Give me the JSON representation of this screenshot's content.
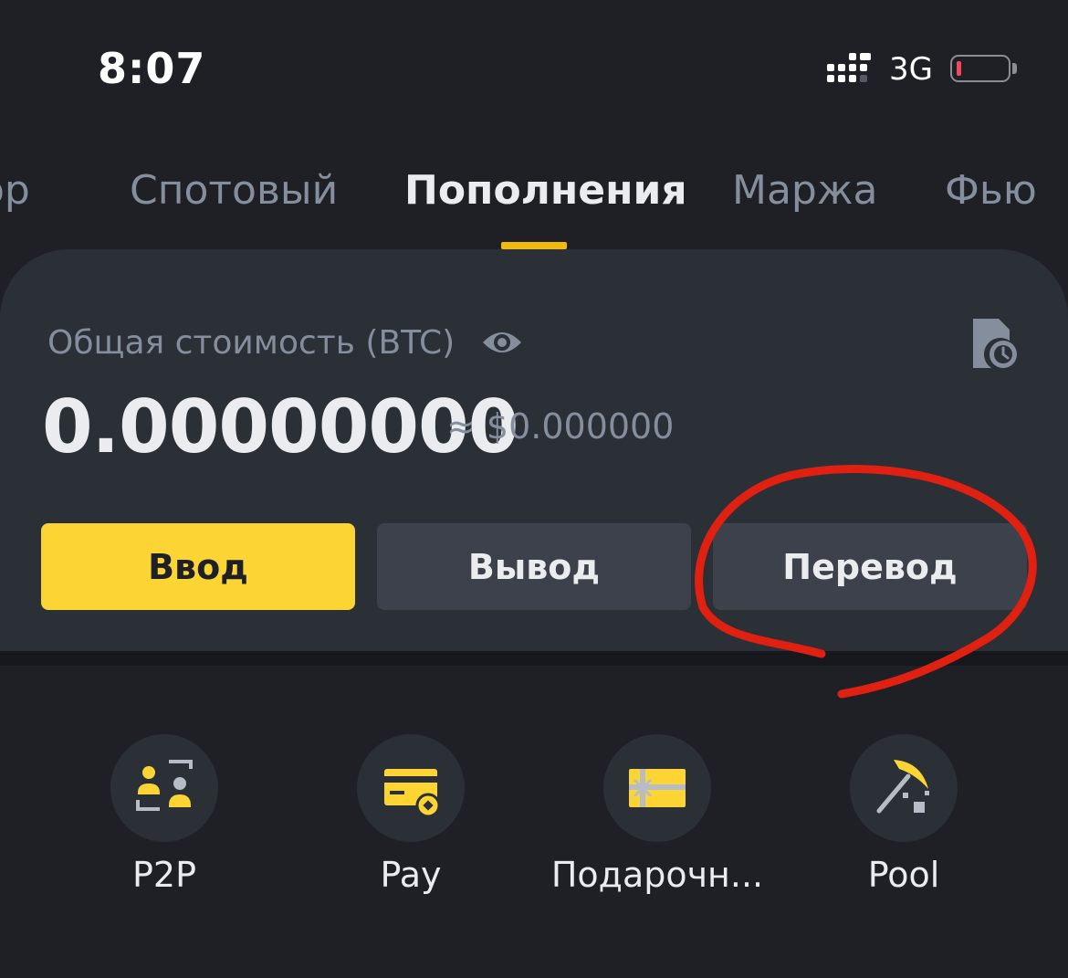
{
  "status_bar": {
    "time": "8:07",
    "network": "3G",
    "battery_color": "#f6465d"
  },
  "tabs": [
    {
      "label": "ор"
    },
    {
      "label": "Спотовый"
    },
    {
      "label": "Пополнения",
      "active": true
    },
    {
      "label": "Маржа"
    },
    {
      "label": "Фью"
    }
  ],
  "balance": {
    "label": "Общая стоимость (BTC)",
    "value": "0.00000000",
    "approx": "≈ $0.000000"
  },
  "actions": {
    "deposit": "Ввод",
    "withdraw": "Вывод",
    "transfer": "Перевод"
  },
  "quick_links": [
    {
      "label": "P2P",
      "icon": "p2p-icon"
    },
    {
      "label": "Pay",
      "icon": "pay-card-icon"
    },
    {
      "label": "Подарочн...",
      "icon": "gift-card-icon"
    },
    {
      "label": "Pool",
      "icon": "mining-pickaxe-icon"
    }
  ],
  "colors": {
    "accent": "#fcd535",
    "background": "#1e2026",
    "card": "#2b2f36",
    "annotation": "#e02010"
  }
}
